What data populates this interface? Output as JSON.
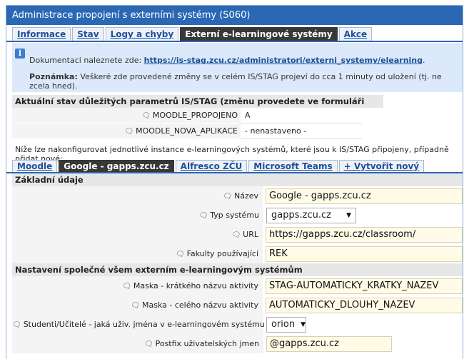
{
  "window": {
    "title": "Administrace propojení s externími systémy (S060)"
  },
  "tabs": [
    {
      "label": "Informace",
      "active": false
    },
    {
      "label": "Stav",
      "active": false
    },
    {
      "label": "Logy a chyby",
      "active": false
    },
    {
      "label": "Externí e-learningové systémy",
      "active": true
    },
    {
      "label": "Akce",
      "active": false
    }
  ],
  "info": {
    "doc_prefix": "Dokumentaci naleznete zde: ",
    "doc_link": "https://is-stag.zcu.cz/administratori/externi_systemy/elearning",
    "doc_suffix": ".",
    "note_label": "Poznámka:",
    "note_text": " Veškeré zde provedené změny se v celém IS/STAG projeví do cca 1 minuty od uložení (tj. ne zcela hned)."
  },
  "status": {
    "header": "Aktuální stav důležitých parametrů IS/STAG (změnu provedete ve formuláři SY0180):",
    "rows": [
      {
        "label": "MOODLE_PROPOJENO",
        "value": "A"
      },
      {
        "label": "MOODLE_NOVA_APLIKACE",
        "value": "- nenastaveno -"
      }
    ]
  },
  "intro": "Níže lze nakonfigurovat jednotlivé instance e-learningových systémů, které jsou k IS/STAG připojeny, případně přidat nové:",
  "subtabs": [
    {
      "label": "Moodle",
      "active": false
    },
    {
      "label": "Google - gapps.zcu.cz",
      "active": true
    },
    {
      "label": "Alfresco ZČU",
      "active": false
    },
    {
      "label": "Microsoft Teams",
      "active": false
    },
    {
      "label": "+ Vytvořit nový",
      "active": false
    }
  ],
  "basic": {
    "header": "Základní údaje",
    "fields": {
      "nazev": {
        "label": "Název",
        "value": "Google - gapps.zcu.cz"
      },
      "typ": {
        "label": "Typ systému",
        "value": "gapps.zcu.cz"
      },
      "url": {
        "label": "URL",
        "value": "https://gapps.zcu.cz/classroom/"
      },
      "fakulty": {
        "label": "Fakulty používající",
        "value": "REK"
      }
    }
  },
  "common": {
    "header": "Nastavení společné všem externím e-learningovým systémům",
    "fields": {
      "maska_kratky": {
        "label": "Maska - krátkého názvu aktivity",
        "value": "STAG-AUTOMATICKY_KRATKY_NAZEV"
      },
      "maska_cely": {
        "label": "Maska - celého názvu aktivity",
        "value": "AUTOMATICKY_DLOUHY_NAZEV"
      },
      "jmena": {
        "label": "Studenti/Učitelé - jaká uživ. jména v e-learningovém systému jsou?",
        "value": "orion"
      },
      "postfix": {
        "label": "Postfix uživatelských jmen",
        "value": "@gapps.zcu.cz"
      }
    }
  },
  "icons": {
    "field_help": "comment-icon",
    "info": "info-icon",
    "dropdown": "chevron-down-icon"
  }
}
